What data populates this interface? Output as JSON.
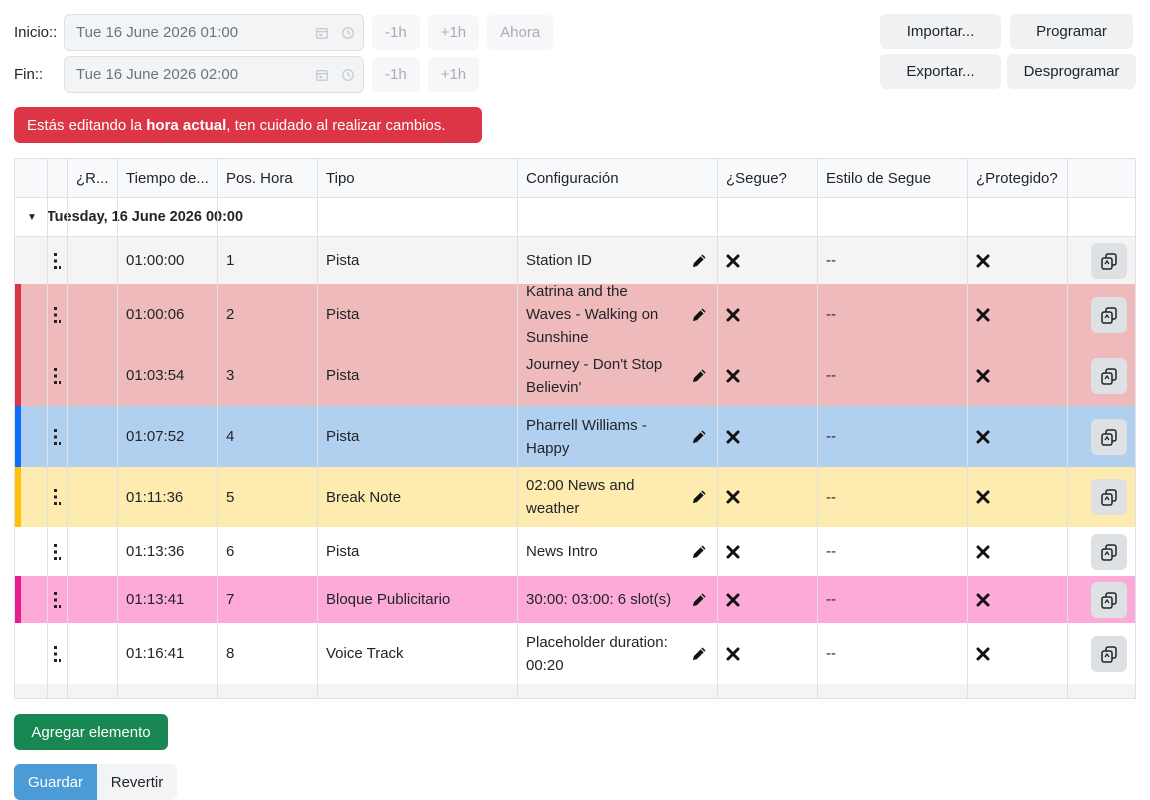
{
  "range": {
    "start_label": "Inicio::",
    "start_value": "Tue 16 June 2026 01:00",
    "end_label": "Fin::",
    "end_value": "Tue 16 June 2026 02:00",
    "minus_label": "-1h",
    "plus_label": "+1h",
    "now_label": "Ahora"
  },
  "actions": {
    "import_label": "Importar...",
    "export_label": "Exportar...",
    "schedule_label": "Programar",
    "unschedule_label": "Desprogramar"
  },
  "alert": {
    "prefix": "Estás editando la ",
    "strong": "hora actual",
    "suffix": ", ten cuidado al realizar cambios.",
    "color": "#dc3545"
  },
  "table": {
    "columns": [
      "",
      "",
      "¿R...",
      "Tiempo de...",
      "Pos. Hora",
      "Tipo",
      "Configuración",
      "¿Segue?",
      "Estilo de Segue",
      "¿Protegido?",
      ""
    ],
    "group_label": "Tuesday, 16 June 2026 00:00",
    "rows": [
      {
        "time": "01:00:00",
        "pos": "1",
        "type": "Pista",
        "config": "Station ID",
        "segue_style": "--",
        "bg": "#f4f4f4",
        "accent": ""
      },
      {
        "time": "01:00:06",
        "pos": "2",
        "type": "Pista",
        "config": "Katrina and the Waves - Walking on Sunshine",
        "segue_style": "--",
        "bg": "#eebabb",
        "accent": "#dc3545"
      },
      {
        "time": "01:03:54",
        "pos": "3",
        "type": "Pista",
        "config": "Journey - Don't Stop Believin'",
        "segue_style": "--",
        "bg": "#eebabb",
        "accent": "#dc3545"
      },
      {
        "time": "01:07:52",
        "pos": "4",
        "type": "Pista",
        "config": "Pharrell Williams - Happy",
        "segue_style": "--",
        "bg": "#b1d0ef",
        "accent": "#0d6efd"
      },
      {
        "time": "01:11:36",
        "pos": "5",
        "type": "Break Note",
        "config": "02:00 News and weather",
        "segue_style": "--",
        "bg": "#fdebb0",
        "accent": "#ffc107"
      },
      {
        "time": "01:13:36",
        "pos": "6",
        "type": "Pista",
        "config": "News Intro",
        "segue_style": "--",
        "bg": "#ffffff",
        "accent": ""
      },
      {
        "time": "01:13:41",
        "pos": "7",
        "type": "Bloque Publicitario",
        "config": "30:00: 03:00: 6 slot(s)",
        "segue_style": "--",
        "bg": "#fdaad8",
        "accent": "#e91e8c"
      },
      {
        "time": "01:16:41",
        "pos": "8",
        "type": "Voice Track",
        "config": "Placeholder duration: 00:20",
        "segue_style": "--",
        "bg": "#ffffff",
        "accent": ""
      }
    ]
  },
  "footer": {
    "add_label": "Agregar elemento",
    "save_label": "Guardar",
    "revert_label": "Revertir"
  }
}
